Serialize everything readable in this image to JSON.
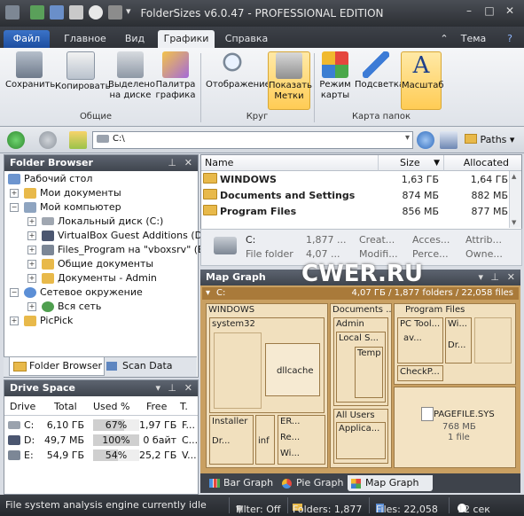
{
  "window": {
    "title": "FolderSizes v6.0.47 - PROFESSIONAL EDITION"
  },
  "ribbon_tabs": [
    {
      "label": "Файл"
    },
    {
      "label": "Главное"
    },
    {
      "label": "Вид"
    },
    {
      "label": "Графики"
    },
    {
      "label": "Справка"
    }
  ],
  "theme_label": "Тема",
  "ribbon": {
    "buttons": [
      {
        "label": "Сохранить"
      },
      {
        "label": "Копировать"
      },
      {
        "label": "Выделено на диске"
      },
      {
        "label": "Палитра графика"
      },
      {
        "label": "Отображение"
      },
      {
        "label": "Показать Метки"
      },
      {
        "label": "Режим карты"
      },
      {
        "label": "Подсветка"
      },
      {
        "label": "Масштаб"
      }
    ],
    "groups": [
      {
        "label": "Общие"
      },
      {
        "label": "Круг"
      },
      {
        "label": "Карта папок"
      }
    ]
  },
  "address": {
    "path": "C:\\",
    "paths_label": "Paths"
  },
  "folder_browser": {
    "title": "Folder Browser",
    "items": [
      {
        "label": "Рабочий стол"
      },
      {
        "label": "Мои документы"
      },
      {
        "label": "Мой компьютер"
      },
      {
        "label": "Локальный диск (C:)"
      },
      {
        "label": "VirtualBox Guest Additions (D:)"
      },
      {
        "label": "Files_Program на \"vboxsrv\" (E:)"
      },
      {
        "label": "Общие документы"
      },
      {
        "label": "Документы - Admin"
      },
      {
        "label": "Сетевое окружение"
      },
      {
        "label": "Вся сеть"
      },
      {
        "label": "PicPick"
      }
    ],
    "tabs": [
      {
        "label": "Folder Browser"
      },
      {
        "label": "Scan Data"
      }
    ]
  },
  "drive_space": {
    "title": "Drive Space",
    "columns": [
      "Drive",
      "Total",
      "Used %",
      "Free",
      "T."
    ],
    "rows": [
      {
        "drive": "C:",
        "total": "6,10 ГБ",
        "used": "67%",
        "used_fraction": 0.67,
        "free": "1,97 ГБ",
        "type": "F..."
      },
      {
        "drive": "D:",
        "total": "49,7 МБ",
        "used": "100%",
        "used_fraction": 1.0,
        "free": "0 байт",
        "type": "C..."
      },
      {
        "drive": "E:",
        "total": "54,9 ГБ",
        "used": "54%",
        "used_fraction": 0.54,
        "free": "25,2 ГБ",
        "type": "V..."
      }
    ]
  },
  "file_list": {
    "columns": [
      "Name",
      "Size",
      "Allocated"
    ],
    "rows": [
      {
        "name": "WINDOWS",
        "size": "1,63 ГБ",
        "allocated": "1,64 ГБ"
      },
      {
        "name": "Documents and Settings",
        "size": "874 МБ",
        "allocated": "882 МБ"
      },
      {
        "name": "Program Files",
        "size": "856 МБ",
        "allocated": "877 МБ"
      }
    ],
    "info": {
      "name": "C:",
      "type": "File folder",
      "v1": "1,877 ...",
      "v2": "4,07 ...",
      "c1": "Creat...",
      "c2": "Modifi...",
      "a1": "Acces...",
      "a2": "Perce...",
      "b1": "Attrib...",
      "b2": "Owne..."
    }
  },
  "map_graph": {
    "title": "Map Graph",
    "root_label": "C:",
    "root_stats": "4,07 ГБ / 1,877 folders / 22,058 files",
    "blocks": [
      {
        "label": "WINDOWS"
      },
      {
        "label": "system32"
      },
      {
        "label": "dllcache"
      },
      {
        "label": "Installer"
      },
      {
        "label": "ER..."
      },
      {
        "label": "Re..."
      },
      {
        "label": "Wi..."
      },
      {
        "label": "Dr..."
      },
      {
        "label": "inf"
      },
      {
        "label": "Documents ..."
      },
      {
        "label": "Admin"
      },
      {
        "label": "Local S..."
      },
      {
        "label": "Temp"
      },
      {
        "label": "All Users"
      },
      {
        "label": "Applica..."
      },
      {
        "label": "Program Files"
      },
      {
        "label": "PC Tool..."
      },
      {
        "label": "av..."
      },
      {
        "label": "Wi..."
      },
      {
        "label": "Dr..."
      },
      {
        "label": "CheckP..."
      },
      {
        "label": "PAGEFILE.SYS"
      },
      {
        "label": "768 МБ"
      },
      {
        "label": "1 file"
      }
    ],
    "tabs": [
      {
        "label": "Bar Graph"
      },
      {
        "label": "Pie Graph"
      },
      {
        "label": "Map Graph"
      }
    ],
    "watermark": "CWER.RU"
  },
  "status": {
    "message": "File system analysis engine currently idle",
    "filter": "Filter: Off",
    "folders": "Folders: 1,877",
    "files": "Files: 22,058",
    "time": "12 сек"
  }
}
